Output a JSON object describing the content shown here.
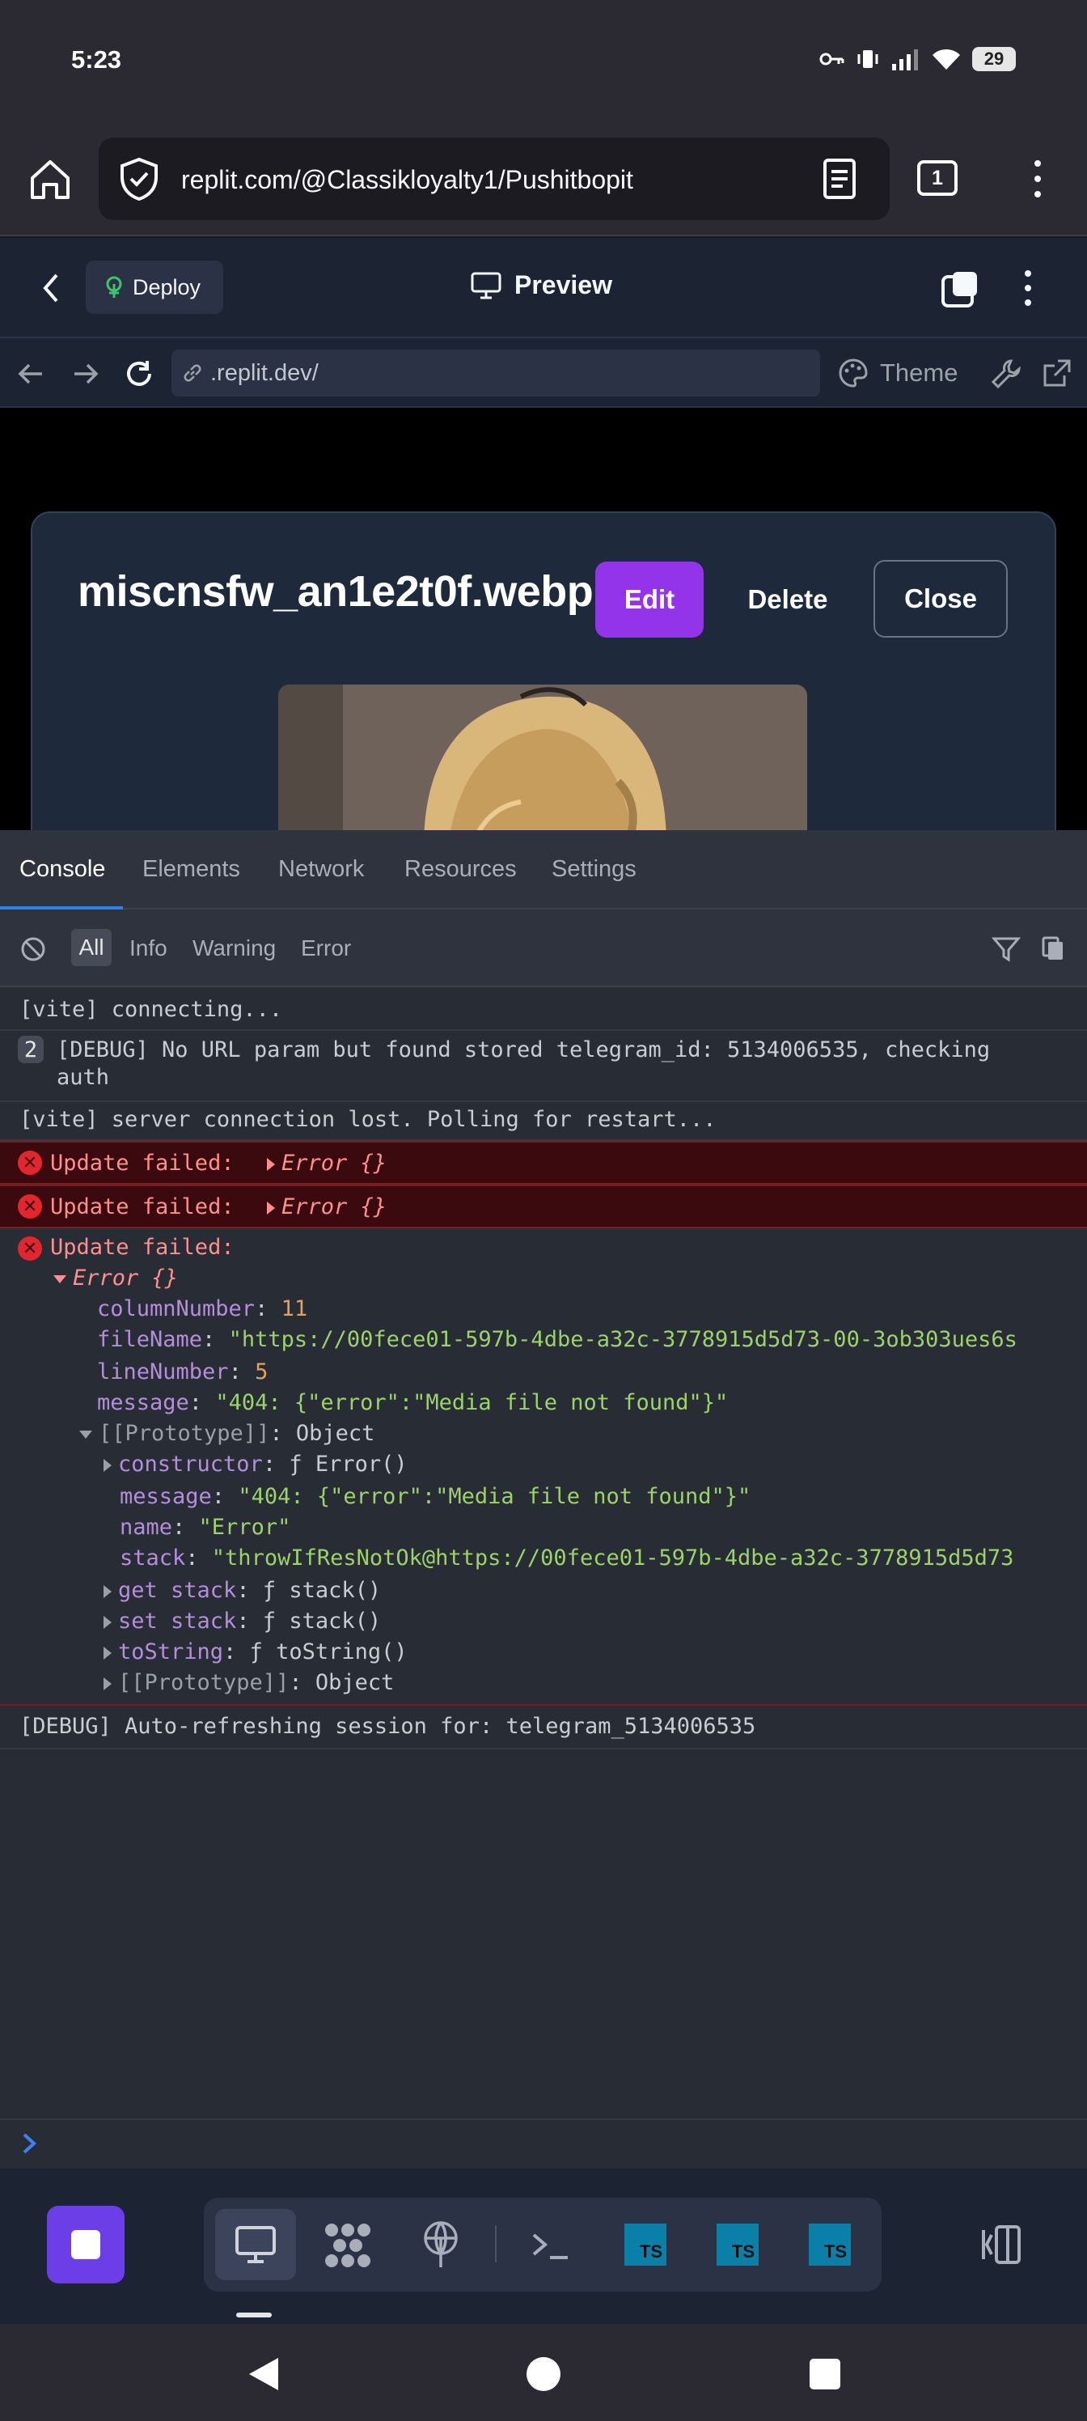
{
  "status_bar": {
    "time": "5:23",
    "battery": "29"
  },
  "browser": {
    "url": "replit.com/@Classikloyalty1/Pushitbopit",
    "tab_count": "1"
  },
  "replit": {
    "deploy_label": "Deploy",
    "preview_label": "Preview",
    "address": ".replit.dev/",
    "theme_label": "Theme"
  },
  "modal": {
    "title": "miscnsfw_an1e2t0f.webp",
    "edit": "Edit",
    "delete": "Delete",
    "close": "Close"
  },
  "devtools": {
    "tabs": [
      "Console",
      "Elements",
      "Network",
      "Resources",
      "Settings"
    ],
    "filters": [
      "All",
      "Info",
      "Warning",
      "Error"
    ],
    "logs": {
      "l1": "[vite] connecting...",
      "l2_count": "2",
      "l2a": "[DEBUG] No URL param but found stored telegram_id: 5134006535, checking",
      "l2b": "auth",
      "l3": "[vite] server connection lost. Polling for restart...",
      "err_label": "Update failed:",
      "err_obj": "Error {}",
      "props": {
        "columnNumber_k": "columnNumber",
        "columnNumber_v": "11",
        "fileName_k": "fileName",
        "fileName_v": "\"https://00fece01-597b-4dbe-a32c-3778915d5d73-00-3ob303ues6s",
        "lineNumber_k": "lineNumber",
        "lineNumber_v": "5",
        "message_k": "message",
        "message_v": "\"404: {\"error\":\"Media file not found\"}\"",
        "proto_k": "[[Prototype]]",
        "proto_v": "Object",
        "constructor_k": "constructor",
        "constructor_v": "ƒ Error()",
        "message2_v": "\"404: {\"error\":\"Media file not found\"}\"",
        "name_k": "name",
        "name_v": "\"Error\"",
        "stack_k": "stack",
        "stack_v": "\"throwIfResNotOk@https://00fece01-597b-4dbe-a32c-3778915d5d73",
        "get_k": "get stack",
        "get_v": "ƒ stack()",
        "set_k": "set stack",
        "set_v": "ƒ stack()",
        "tostring_k": "toString",
        "tostring_v": "ƒ toString()",
        "proto2_k": "[[Prototype]]",
        "proto2_v": "Object"
      },
      "l_last": "[DEBUG] Auto-refreshing session for: telegram_5134006535"
    }
  },
  "dock": {
    "ts": "TS"
  }
}
